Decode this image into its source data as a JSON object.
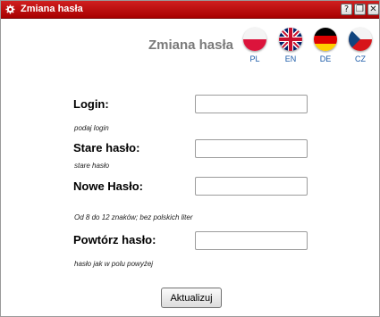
{
  "window": {
    "title": "Zmiana hasła",
    "help_button": "?",
    "restore_button": "❐",
    "close_button": "✕"
  },
  "header": {
    "title": "Zmiana hasła"
  },
  "languages": [
    {
      "code": "PL",
      "icon": "poland-flag-icon"
    },
    {
      "code": "EN",
      "icon": "uk-flag-icon"
    },
    {
      "code": "DE",
      "icon": "germany-flag-icon"
    },
    {
      "code": "CZ",
      "icon": "czech-flag-icon"
    }
  ],
  "form": {
    "login": {
      "label": "Login:",
      "hint": "podaj login",
      "value": ""
    },
    "old_password": {
      "label": "Stare hasło:",
      "hint": "stare hasło",
      "value": ""
    },
    "new_password": {
      "label": "Nowe Hasło:",
      "hint": "Od 8 do 12 znaków; bez polskich liter",
      "value": ""
    },
    "repeat_password": {
      "label": "Powtórz hasło:",
      "hint": "hasło jak w polu powyżej",
      "value": ""
    },
    "submit_label": "Aktualizuj"
  },
  "colors": {
    "titlebar": "#b80000",
    "heading": "#7a7a7a",
    "language_code": "#1a5aa8"
  }
}
